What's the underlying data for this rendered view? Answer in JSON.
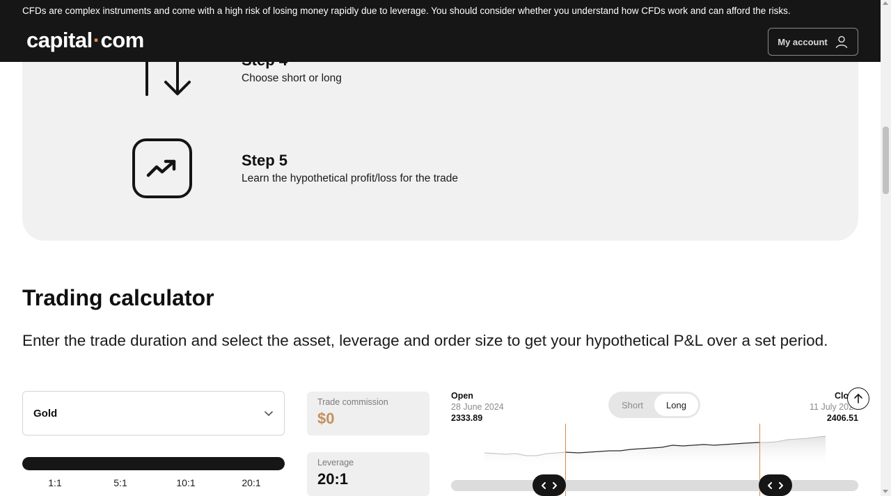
{
  "header": {
    "risk_warning": "CFDs are complex instruments and come with a high risk of losing money rapidly due to leverage. You should consider whether you understand how CFDs work and can afford the risks.",
    "logo_left": "capital",
    "logo_dot": "·",
    "logo_right": "com",
    "account_label": "My account"
  },
  "steps": [
    {
      "title": "Step 4",
      "description": "Choose short or long",
      "icon": "arrows-up-down-icon"
    },
    {
      "title": "Step 5",
      "description": "Learn the hypothetical profit/loss for the trade",
      "icon": "trend-up-icon"
    }
  ],
  "calculator": {
    "title": "Trading calculator",
    "description": "Enter the trade duration and select the asset, leverage and order size to get your hypothetical P&L over a set period.",
    "asset_selected": "Gold",
    "leverage_options": [
      "1:1",
      "5:1",
      "10:1",
      "20:1"
    ],
    "leverage_selected_index": 3,
    "commission_label": "Trade commission",
    "commission_value": "$0",
    "leverage_label": "Leverage",
    "leverage_value": "20:1",
    "open_label": "Open",
    "open_date": "28 June 2024",
    "open_price": "2333.89",
    "close_label": "Close",
    "close_date": "11 July 2024",
    "close_price": "2406.51",
    "direction_options": [
      "Short",
      "Long"
    ],
    "direction_selected": "Long"
  },
  "colors": {
    "header_bg": "#161616",
    "accent_orange": "#e38f4d",
    "commission_gold": "#c4905c",
    "panel_bg": "#f1f1f2"
  }
}
